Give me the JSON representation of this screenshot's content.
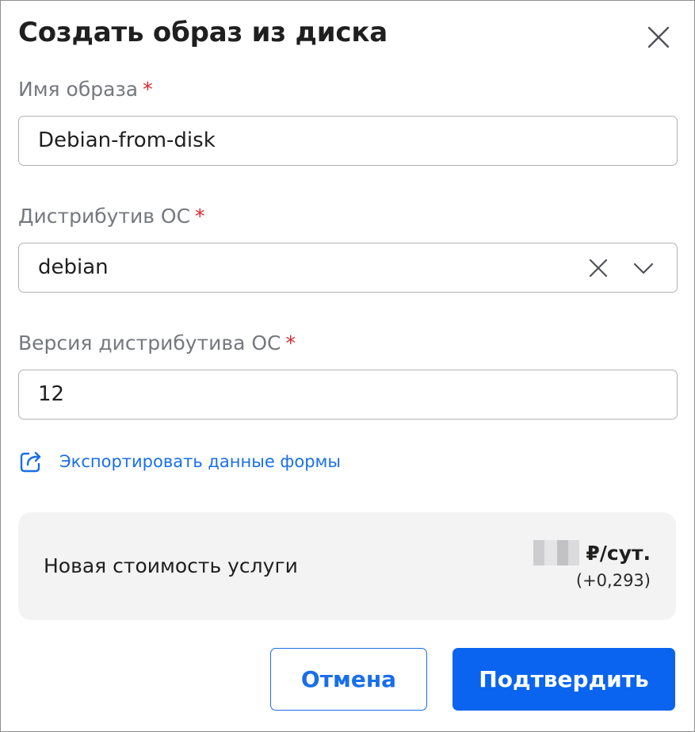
{
  "dialog": {
    "title": "Создать образ из диска",
    "close_icon": "close-icon"
  },
  "fields": {
    "image_name": {
      "label": "Имя образа",
      "required_mark": "*",
      "value": "Debian-from-disk"
    },
    "os_distro": {
      "label": "Дистрибутив ОС",
      "required_mark": "*",
      "value": "debian",
      "clear_icon": "clear-icon",
      "dropdown_icon": "chevron-down-icon"
    },
    "os_version": {
      "label": "Версия дистрибутива ОС",
      "required_mark": "*",
      "value": "12"
    }
  },
  "export": {
    "label": "Экспортировать данные формы",
    "icon": "export-icon"
  },
  "cost": {
    "label": "Новая стоимость услуги",
    "unit": "₽/сут.",
    "delta": "(+0,293)"
  },
  "buttons": {
    "cancel_label": "Отмена",
    "confirm_label": "Подтвердить"
  },
  "colors": {
    "accent": "#1a6fe8",
    "primary_button": "#0a64f0",
    "required": "#d8262b",
    "cost_background": "#f3f3f4"
  }
}
